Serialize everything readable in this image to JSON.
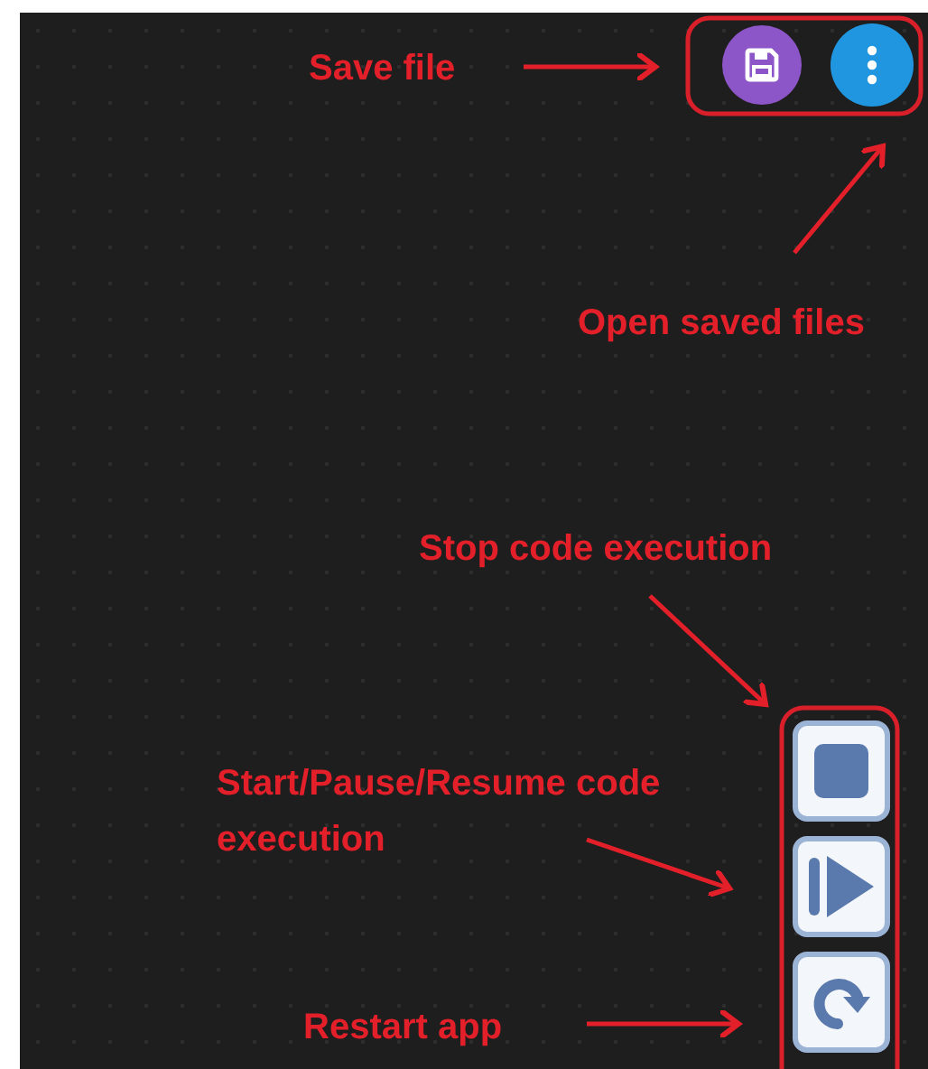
{
  "annotations": [
    {
      "text": "Save file"
    },
    {
      "text": "Open saved files"
    },
    {
      "text": "Stop code execution"
    },
    {
      "text": "Start/Pause/Resume code execution"
    },
    {
      "text": "Restart app"
    }
  ],
  "top_buttons": [
    {
      "kind": "save"
    },
    {
      "kind": "menu"
    }
  ],
  "control_buttons": [
    {
      "kind": "stop"
    },
    {
      "kind": "play"
    },
    {
      "kind": "restart"
    }
  ]
}
